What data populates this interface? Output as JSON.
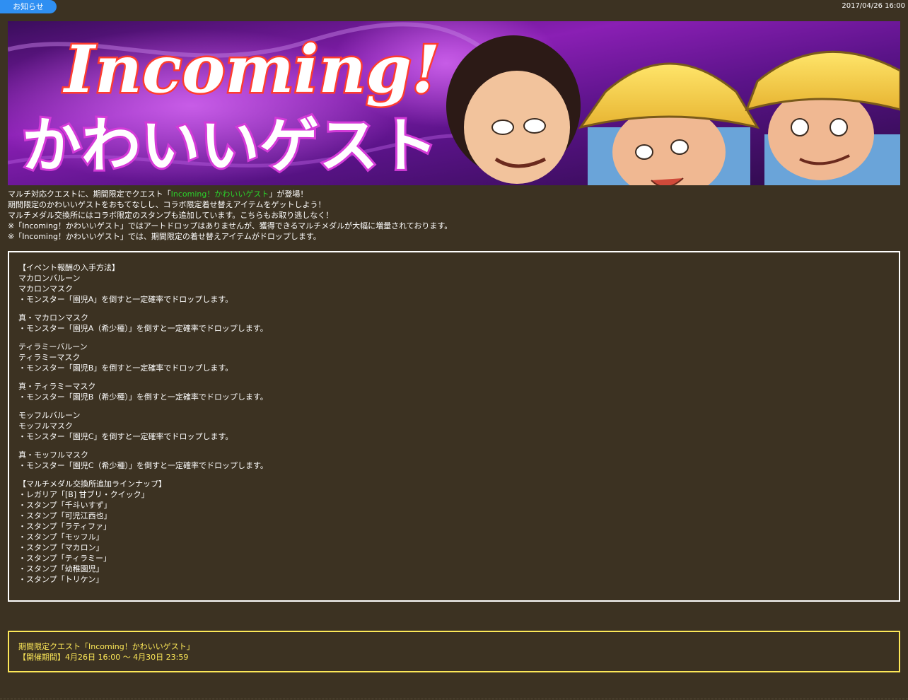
{
  "header": {
    "tag_label": "お知らせ",
    "date": "2017/04/26 16:00"
  },
  "banner": {
    "title_line1": "Incoming!",
    "title_line2": "かわいいゲスト"
  },
  "intro": {
    "line1_prefix": "マルチ対応クエストに、期間限定でクエスト「",
    "line1_highlight": "Incoming！かわいいゲスト",
    "line1_suffix": "」が登場！",
    "line2": "期間限定のかわいいゲストをおもてなしし、コラボ限定着せ替えアイテムをゲットしよう！",
    "line3": "マルチメダル交換所にはコラボ限定のスタンプも追加しています。こちらもお取り逃しなく！",
    "line4": "※「Incoming！かわいいゲスト」ではアートドロップはありませんが、獲得できるマルチメダルが大幅に増量されております。",
    "line5": "※「Incoming！かわいいゲスト」では、期間限定の着せ替えアイテムがドロップします。"
  },
  "rewards": {
    "groups": [
      [
        "【イベント報酬の入手方法】",
        "マカロンバルーン",
        "マカロンマスク",
        "・モンスター「園児A」を倒すと一定確率でドロップします。"
      ],
      [
        "真・マカロンマスク",
        "・モンスター「園児A（希少種）」を倒すと一定確率でドロップします。"
      ],
      [
        "ティラミーバルーン",
        "ティラミーマスク",
        "・モンスター「園児B」を倒すと一定確率でドロップします。"
      ],
      [
        "真・ティラミーマスク",
        "・モンスター「園児B（希少種）」を倒すと一定確率でドロップします。"
      ],
      [
        "モッフルバルーン",
        "モッフルマスク",
        "・モンスター「園児C」を倒すと一定確率でドロップします。"
      ],
      [
        "真・モッフルマスク",
        "・モンスター「園児C（希少種）」を倒すと一定確率でドロップします。"
      ],
      [
        "【マルチメダル交換所追加ラインナップ】",
        "・レガリア「[B] 甘ブリ・クイック」",
        "・スタンプ「千斗いすず」",
        "・スタンプ「可児江西也」",
        "・スタンプ「ラティファ」",
        "・スタンプ「モッフル」",
        "・スタンプ「マカロン」",
        "・スタンプ「ティラミー」",
        "・スタンプ「幼稚園児」",
        "・スタンプ「トリケン」"
      ]
    ]
  },
  "period": {
    "line1": "期間限定クエスト「Incoming！かわいいゲスト」",
    "line2": "【開催期間】4月26日 16:00 ～ 4月30日 23:59"
  },
  "colors": {
    "background": "#3c3222",
    "tag": "#2f8ff2",
    "highlight": "#2bd12b",
    "period_text": "#fde858"
  }
}
